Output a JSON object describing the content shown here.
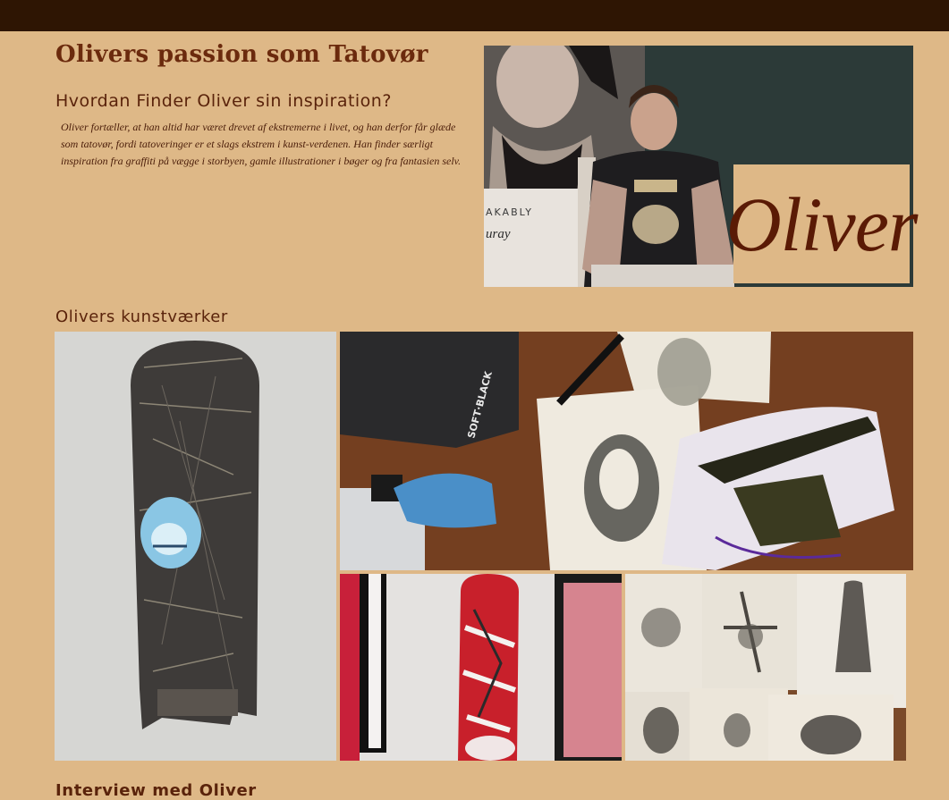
{
  "header": {
    "title": "Olivers passion som Tatovør"
  },
  "inspiration": {
    "heading": "Hvordan Finder Oliver sin inspiration?",
    "text": "Oliver fortæller, at han altid har været drevet af ekstremerne i livet, og han derfor får glæde som tatovør, fordi tatoveringer er et slags ekstrem i kunst-verdenen. Han finder særligt inspiration fra graffiti på vægge i storbyen, gamle illustrationer i bøger og fra fantasien selv."
  },
  "portrait": {
    "name_overlay": "Oliver",
    "bag_text": "AKABLY",
    "bag_script": "uray"
  },
  "artworks": {
    "heading": "Olivers kunstværker",
    "box_label": "SOFT·BLACK"
  },
  "interview": {
    "heading": "Interview med Oliver"
  },
  "colors": {
    "background": "#deb887",
    "topbar": "#2e1503",
    "title": "#6b2a0d",
    "text": "#4a1c08"
  }
}
